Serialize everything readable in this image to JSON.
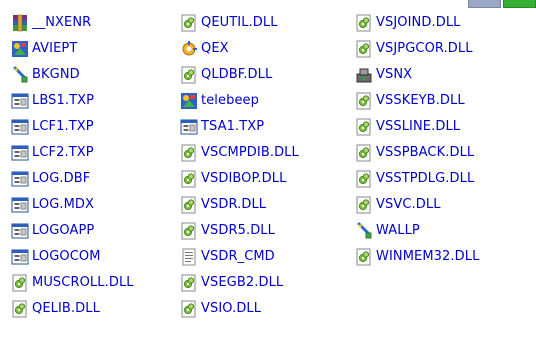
{
  "columns": [
    [
      {
        "name": "__NXENR",
        "icon": "winrar-archive-icon"
      },
      {
        "name": "AVIEPT",
        "icon": "application-icon"
      },
      {
        "name": "BKGND",
        "icon": "shortcut-icon"
      },
      {
        "name": "LBS1.TXP",
        "icon": "txp-file-icon"
      },
      {
        "name": "LCF1.TXP",
        "icon": "txp-file-icon"
      },
      {
        "name": "LCF2.TXP",
        "icon": "txp-file-icon"
      },
      {
        "name": "LOG.DBF",
        "icon": "txp-file-icon"
      },
      {
        "name": "LOG.MDX",
        "icon": "txp-file-icon"
      },
      {
        "name": "LOGOAPP",
        "icon": "txp-file-icon"
      },
      {
        "name": "LOGOCOM",
        "icon": "txp-file-icon"
      },
      {
        "name": "MUSCROLL.DLL",
        "icon": "dll-file-icon"
      },
      {
        "name": "QELIB.DLL",
        "icon": "dll-file-icon"
      }
    ],
    [
      {
        "name": "QEUTIL.DLL",
        "icon": "dll-file-icon"
      },
      {
        "name": "QEX",
        "icon": "settings-app-icon"
      },
      {
        "name": "QLDBF.DLL",
        "icon": "dll-file-icon"
      },
      {
        "name": "telebeep",
        "icon": "application-icon"
      },
      {
        "name": "TSA1.TXP",
        "icon": "txp-file-icon"
      },
      {
        "name": "VSCMPDIB.DLL",
        "icon": "dll-file-icon"
      },
      {
        "name": "VSDIBOP.DLL",
        "icon": "dll-file-icon"
      },
      {
        "name": "VSDR.DLL",
        "icon": "dll-file-icon"
      },
      {
        "name": "VSDR5.DLL",
        "icon": "dll-file-icon"
      },
      {
        "name": "VSDR_CMD",
        "icon": "text-document-icon"
      },
      {
        "name": "VSEGB2.DLL",
        "icon": "dll-file-icon"
      },
      {
        "name": "VSIO.DLL",
        "icon": "dll-file-icon"
      }
    ],
    [
      {
        "name": "VSJOIND.DLL",
        "icon": "dll-file-icon"
      },
      {
        "name": "VSJPGCOR.DLL",
        "icon": "dll-file-icon"
      },
      {
        "name": "VSNX",
        "icon": "tools-app-icon"
      },
      {
        "name": "VSSKEYB.DLL",
        "icon": "dll-file-icon"
      },
      {
        "name": "VSSLINE.DLL",
        "icon": "dll-file-icon"
      },
      {
        "name": "VSSPBACK.DLL",
        "icon": "dll-file-icon"
      },
      {
        "name": "VSSTPDLG.DLL",
        "icon": "dll-file-icon"
      },
      {
        "name": "VSVC.DLL",
        "icon": "dll-file-icon"
      },
      {
        "name": "WALLP",
        "icon": "shortcut-icon"
      },
      {
        "name": "WINMEM32.DLL",
        "icon": "dll-file-icon"
      }
    ]
  ],
  "colors": {
    "label": "#0000cc",
    "background": "#ffffff"
  }
}
